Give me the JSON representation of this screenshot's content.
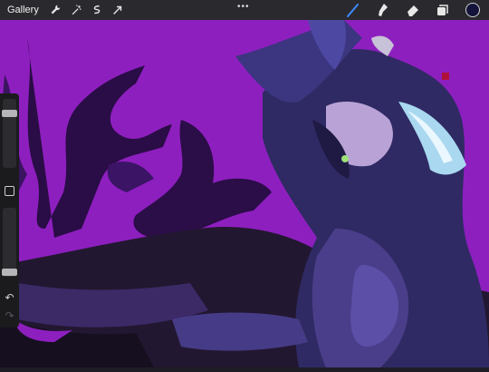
{
  "toolbar": {
    "gallery_label": "Gallery",
    "more_dots": "•••",
    "accent_color": "#3f8bff",
    "current_color": "#14133a",
    "left_tools": [
      "wrench-icon",
      "magic-wand-icon",
      "selection-icon",
      "transform-arrow-icon"
    ],
    "right_tools": [
      "brush-icon",
      "smudge-icon",
      "eraser-icon",
      "layers-icon"
    ]
  },
  "sidebar": {
    "brush_size_level": 0.82,
    "opacity_level": 0.02,
    "undo_glyph": "↶",
    "redo_glyph": "↷"
  },
  "canvas": {
    "background_color": "#8e1fbf"
  }
}
